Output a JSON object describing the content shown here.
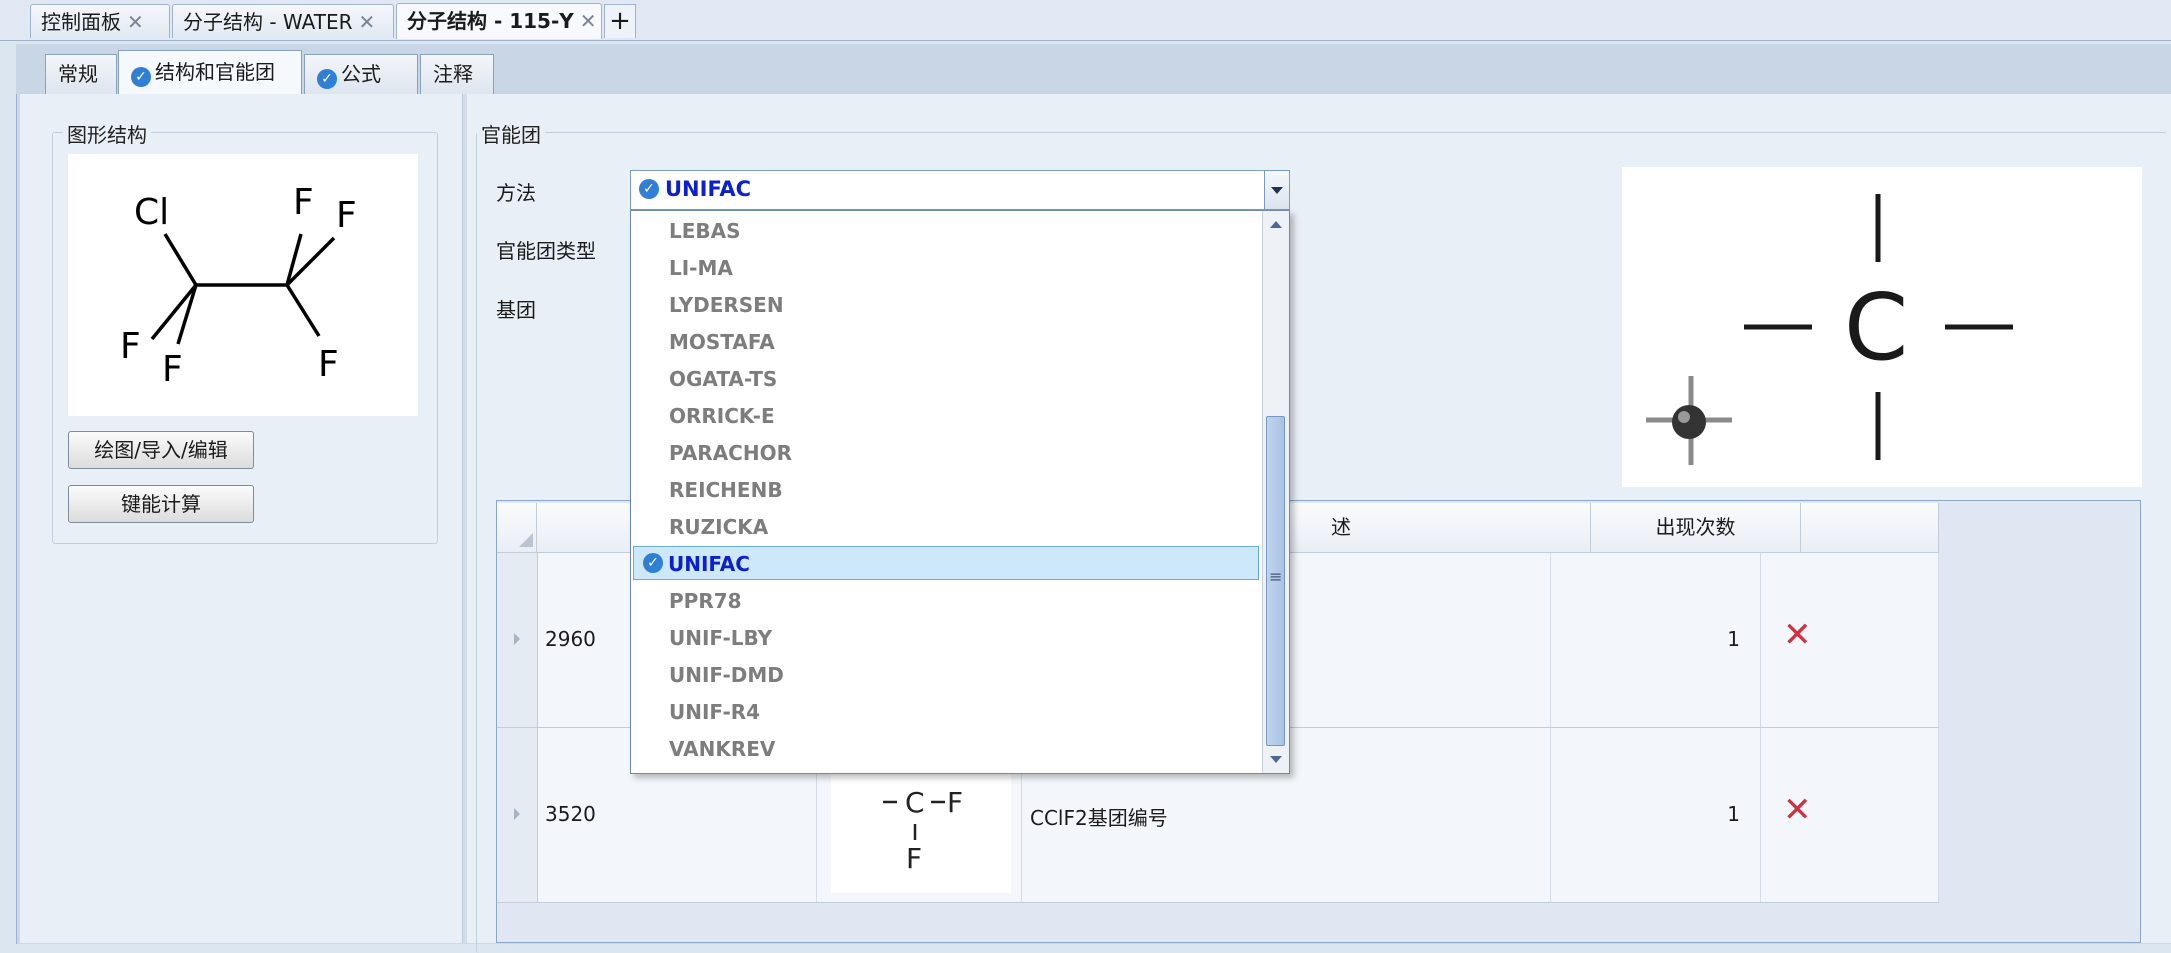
{
  "doc_tabs": [
    {
      "label": "控制面板",
      "active": false
    },
    {
      "label": "分子结构 - WATER",
      "active": false
    },
    {
      "label": "分子结构 - 115-Y",
      "active": true
    }
  ],
  "doc_tab_close": "✕",
  "add_tab": "+",
  "sub_tabs": [
    {
      "label": "常规",
      "checked": false
    },
    {
      "label": "结构和官能团",
      "checked": true
    },
    {
      "label": "公式",
      "checked": true
    },
    {
      "label": "注释",
      "checked": false
    }
  ],
  "structure": {
    "group_title": "图形结构",
    "atoms": {
      "cl": "Cl",
      "f": "F"
    },
    "draw_button": "绘图/导入/编辑",
    "bond_button": "键能计算"
  },
  "functional": {
    "group_title": "官能团",
    "method_label": "方法",
    "type_label": "官能团类型",
    "group_label": "基团",
    "method_value": "UNIFAC",
    "center_atom": "C"
  },
  "dropdown": {
    "items": [
      "LEBAS",
      "LI-MA",
      "LYDERSEN",
      "MOSTAFA",
      "OGATA-TS",
      "ORRICK-E",
      "PARACHOR",
      "REICHENB",
      "RUZICKA",
      "UNIFAC",
      "PPR78",
      "UNIF-LBY",
      "UNIF-DMD",
      "UNIF-R4",
      "VANKREV"
    ],
    "selected": "UNIFAC"
  },
  "grid": {
    "headers": {
      "desc": "述",
      "count": "出现次数"
    },
    "rows": [
      {
        "id": "2960",
        "description": "",
        "count": "1"
      },
      {
        "id": "3520",
        "description": "CClF2基团编号",
        "count": "1",
        "formula": {
          "c": "C",
          "f": "F"
        }
      }
    ],
    "delete_icon": "✕"
  },
  "colors": {
    "accent": "#0c1fd0",
    "delete": "#d0303f",
    "check": "#2f7fd6"
  }
}
